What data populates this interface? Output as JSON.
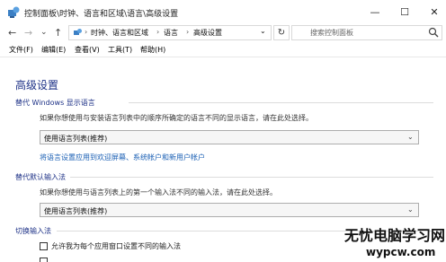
{
  "window": {
    "title": "控制面板\\时钟、语言和区域\\语言\\高级设置",
    "minimize_glyph": "—",
    "maximize_glyph": "☐",
    "close_glyph": "✕"
  },
  "nav": {
    "back_glyph": "←",
    "forward_glyph": "→",
    "recent_glyph": "⌄",
    "up_glyph": "↑",
    "breadcrumbs": [
      "时钟、语言和区域",
      "语言",
      "高级设置"
    ],
    "separator": "›",
    "dropdown_glyph": "⌄",
    "refresh_glyph": "↻",
    "search_placeholder": "搜索控制面板"
  },
  "menu": {
    "items": [
      "文件(F)",
      "编辑(E)",
      "查看(V)",
      "工具(T)",
      "帮助(H)"
    ]
  },
  "content": {
    "page_title": "高级设置",
    "display_lang": {
      "heading": "替代 Windows 显示语言",
      "description": "如果你想使用与安装语言列表中的顺序所确定的语言不同的显示语言，请在此处选择。",
      "selected": "使用语言列表(推荐)",
      "link": "将语言设置应用到欢迎屏幕、系统帐户和新用户帐户"
    },
    "input_method": {
      "heading": "替代默认输入法",
      "description": "如果你想使用与语言列表上的第一个输入法不同的输入法，请在此处选择。",
      "selected": "使用语言列表(推荐)"
    },
    "switch_input": {
      "heading": "切换输入法",
      "checkbox_label": "允许我为每个应用窗口设置不同的输入法",
      "checked": false
    }
  },
  "watermark": {
    "line1": "无忧电脑学习网",
    "line2": "wypcw.com"
  },
  "colors": {
    "heading_blue": "#1e3287",
    "link_blue": "#1a5fb4"
  }
}
